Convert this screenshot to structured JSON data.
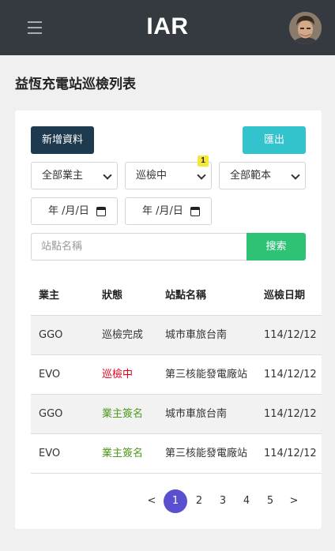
{
  "header": {
    "brand": "IAR"
  },
  "page": {
    "title": "益恆充電站巡檢列表"
  },
  "toolbar": {
    "add_label": "新增資料",
    "export_label": "匯出"
  },
  "filters": {
    "owner": "全部業主",
    "status": "巡檢中",
    "status_badge": "1",
    "template": "全部範本",
    "date_start": "年 /月/日",
    "date_end": "年 /月/日"
  },
  "search": {
    "placeholder": "站點名稱",
    "button_label": "搜索"
  },
  "table": {
    "headers": [
      "業主",
      "狀態",
      "站點名稱",
      "巡檢日期"
    ],
    "rows": [
      {
        "owner": "GGO",
        "status": "巡檢完成",
        "station": "城市車旅台南",
        "date": "114/12/12"
      },
      {
        "owner": "EVO",
        "status": "巡檢中",
        "station": "第三核能發電廠站",
        "date": "114/12/12"
      },
      {
        "owner": "GGO",
        "status": "業主簽名",
        "station": "城市車旅台南",
        "date": "114/12/12"
      },
      {
        "owner": "EVO",
        "status": "業主簽名",
        "station": "第三核能發電廠站",
        "date": "114/12/12"
      }
    ]
  },
  "pagination": {
    "prev": "<",
    "pages": [
      "1",
      "2",
      "3",
      "4",
      "5"
    ],
    "next": ">",
    "current": "1"
  },
  "colors": {
    "topbar": "#343a40",
    "add_button": "#1d3a4f",
    "export_button": "#33c3cd",
    "search_button": "#2ec275",
    "status_in_progress": "#e0001b",
    "status_signed": "#4f9a1d",
    "pagination_active": "#5a4fcf",
    "badge": "#f5e63b"
  }
}
